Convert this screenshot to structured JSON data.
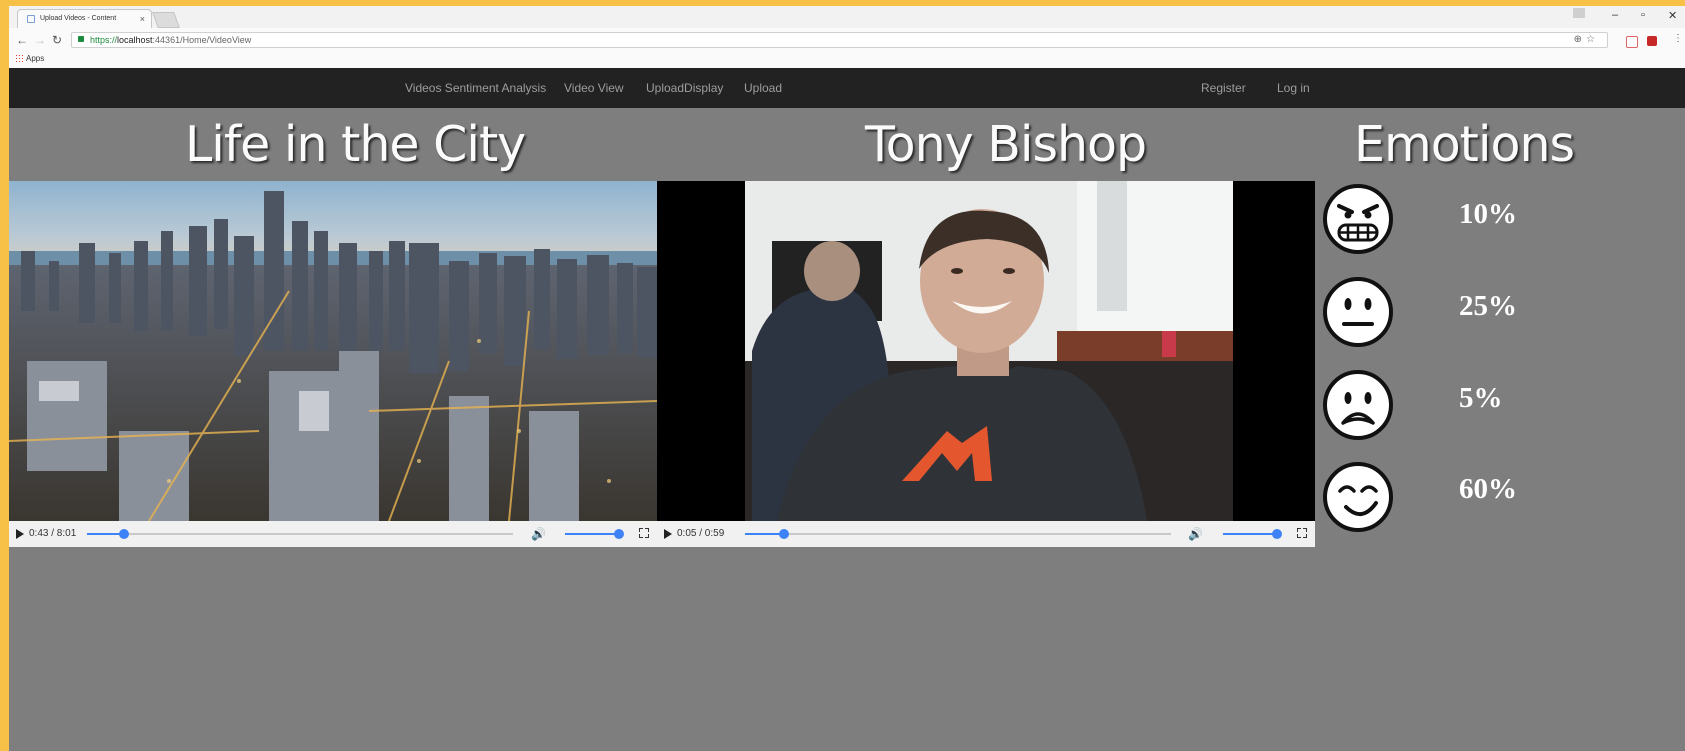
{
  "browser": {
    "tab_title": "Upload Videos - Content",
    "tab_close": "×",
    "url_scheme": "https://",
    "url_host": "localhost",
    "url_rest": ":44361/Home/VideoView",
    "apps_label": "Apps",
    "minimize": "–",
    "restore": "▫",
    "close": "✕"
  },
  "nav": {
    "links": [
      "Videos Sentiment Analysis",
      "Video View",
      "UploadDisplay",
      "Upload"
    ],
    "auth": [
      "Register",
      "Log in"
    ]
  },
  "left": {
    "title": "Life in the City",
    "time": "0:43 / 8:01",
    "progress": 0.088,
    "volume": 1.0
  },
  "right": {
    "title": "Tony Bishop",
    "time": "0:05 / 0:59",
    "progress": 0.092,
    "volume": 1.0
  },
  "emotions": {
    "title": "Emotions",
    "items": [
      {
        "icon": "angry-face-icon",
        "percent": "10%"
      },
      {
        "icon": "neutral-face-icon",
        "percent": "25%"
      },
      {
        "icon": "sad-face-icon",
        "percent": "5%"
      },
      {
        "icon": "happy-face-icon",
        "percent": "60%"
      }
    ]
  },
  "colors": {
    "page_bg": "#7e7e7e",
    "navbar_bg": "#222222",
    "accent": "#3e82f7"
  }
}
